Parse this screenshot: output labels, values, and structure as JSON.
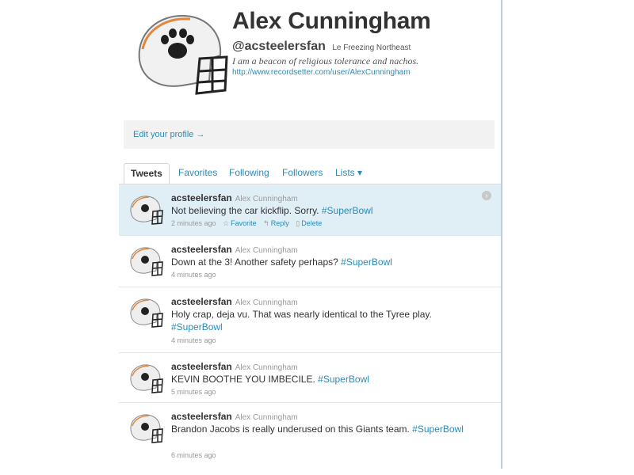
{
  "profile": {
    "name": "Alex Cunningham",
    "handle": "@acsteelersfan",
    "location": "Le Freezing Northeast",
    "bio": "I am a beacon of religious tolerance and nachos.",
    "url": "http://www.recordsetter.com/user/AlexCunningham",
    "edit_profile": "Edit your profile →"
  },
  "tabs": [
    "Tweets",
    "Favorites",
    "Following",
    "Followers",
    "Lists ▾"
  ],
  "actions": {
    "favorite": "Favorite",
    "reply": "Reply",
    "delete": "Delete"
  },
  "tweets": [
    {
      "user": "acsteelersfan",
      "fullname": "Alex Cunningham",
      "text": "Not believing the car kickflip. Sorry. ",
      "hashtag": "#SuperBowl",
      "time": "2 minutes ago"
    },
    {
      "user": "acsteelersfan",
      "fullname": "Alex Cunningham",
      "text": "Down at the 3! Another safety perhaps? ",
      "hashtag": "#SuperBowl",
      "time": "4 minutes ago"
    },
    {
      "user": "acsteelersfan",
      "fullname": "Alex Cunningham",
      "text": "Holy crap, deja vu. That was nearly identical to the Tyree play. ",
      "hashtag": "#SuperBowl",
      "time": "4 minutes ago"
    },
    {
      "user": "acsteelersfan",
      "fullname": "Alex Cunningham",
      "text": "KEVIN BOOTHE YOU IMBECILE. ",
      "hashtag": "#SuperBowl",
      "time": "5 minutes ago"
    },
    {
      "user": "acsteelersfan",
      "fullname": "Alex Cunningham",
      "text": "Brandon Jacobs is really underused on this Giants team. ",
      "hashtag": "#SuperBowl",
      "time": "6 minutes ago"
    }
  ],
  "colors": {
    "link": "#2b8bb7",
    "highlight": "#dfeff5",
    "helmet_stripe": "#e2873a"
  }
}
